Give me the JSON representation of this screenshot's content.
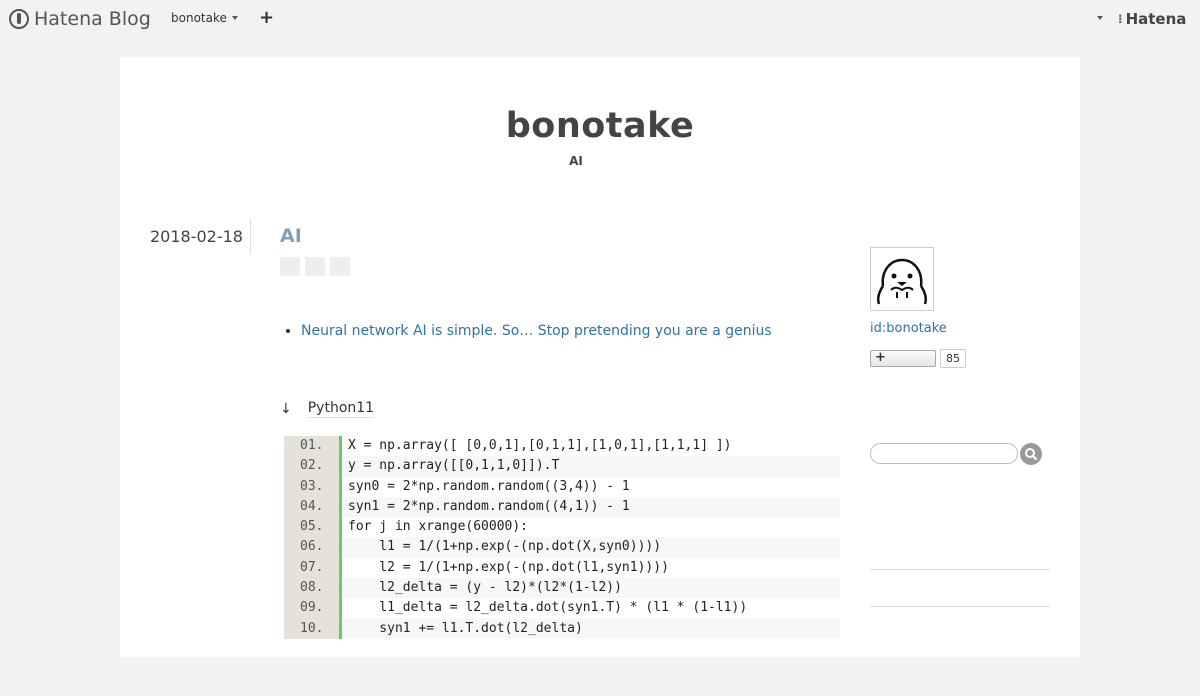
{
  "header": {
    "brand": "Hatena Blog",
    "blog_switch": "bonotake",
    "add_symbol": "+",
    "hatena_logo": "Hatena"
  },
  "blog": {
    "title": "bonotake",
    "description": "AI"
  },
  "entry": {
    "date": "2018-02-18",
    "title": "AI",
    "links": [
      "Neural network AI is simple. So… Stop pretending you are a genius"
    ],
    "arrow": "↓",
    "language_label": "Python11"
  },
  "code": {
    "lines": [
      {
        "no": "01.",
        "text": "X = np.array([ [0,0,1],[0,1,1],[1,0,1],[1,1,1] ])"
      },
      {
        "no": "02.",
        "text": "y = np.array([[0,1,1,0]]).T"
      },
      {
        "no": "03.",
        "text": "syn0 = 2*np.random.random((3,4)) - 1"
      },
      {
        "no": "04.",
        "text": "syn1 = 2*np.random.random((4,1)) - 1"
      },
      {
        "no": "05.",
        "text": "for j in xrange(60000):"
      },
      {
        "no": "06.",
        "text": "    l1 = 1/(1+np.exp(-(np.dot(X,syn0))))"
      },
      {
        "no": "07.",
        "text": "    l2 = 1/(1+np.exp(-(np.dot(l1,syn1))))"
      },
      {
        "no": "08.",
        "text": "    l2_delta = (y - l2)*(l2*(1-l2))"
      },
      {
        "no": "09.",
        "text": "    l1_delta = l2_delta.dot(syn1.T) * (l1 * (1-l1))"
      },
      {
        "no": "10.",
        "text": "    syn1 += l1.T.dot(l2_delta)"
      }
    ]
  },
  "sidebar": {
    "profile_id": "id:bonotake",
    "subscribe_symbol": "+",
    "subscriber_count": "85"
  },
  "colors": {
    "accent_link": "#2f73a8",
    "entry_title": "#7e9fbf",
    "gutter_border": "#66cc66"
  }
}
